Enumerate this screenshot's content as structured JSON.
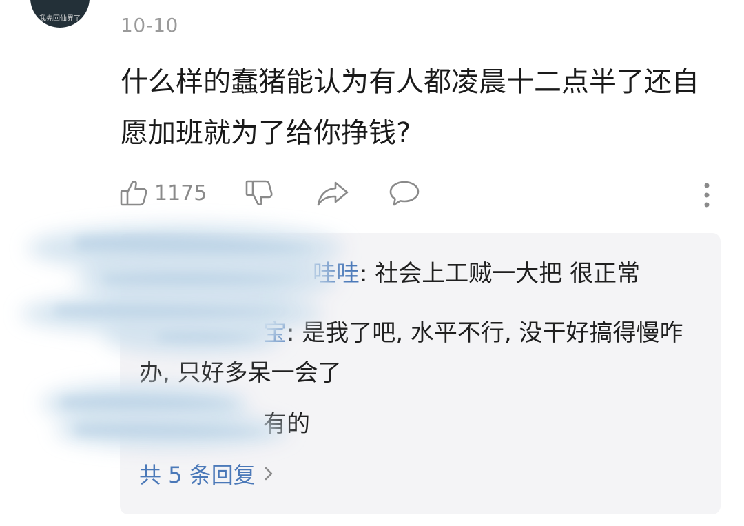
{
  "comment": {
    "avatar_caption": "我先回仙界了",
    "date": "10-10",
    "text": "什么样的蠢猪能认为有人都凌晨十二点半了还自愿加班就为了给你挣钱?",
    "like_count": "1175",
    "icons": [
      "thumbs-up-icon",
      "thumbs-down-icon",
      "share-icon",
      "comment-icon",
      "more-icon"
    ]
  },
  "replies": {
    "items": [
      {
        "user": "哇哇",
        "sep": ": ",
        "text": "社会上工贼一大把 很正常"
      },
      {
        "user": "宝",
        "sep": ": ",
        "text": "是我了吧, 水平不行, 没干好搞得慢咋办, 只好多呆一会了"
      },
      {
        "user": "",
        "sep": "",
        "text": "有的"
      }
    ],
    "more_label": "共 5 条回复"
  },
  "colors": {
    "link": "#4a78b8",
    "meta": "#9a9a9a",
    "panel": "#f4f4f6",
    "smear": "#cfe0ee"
  }
}
